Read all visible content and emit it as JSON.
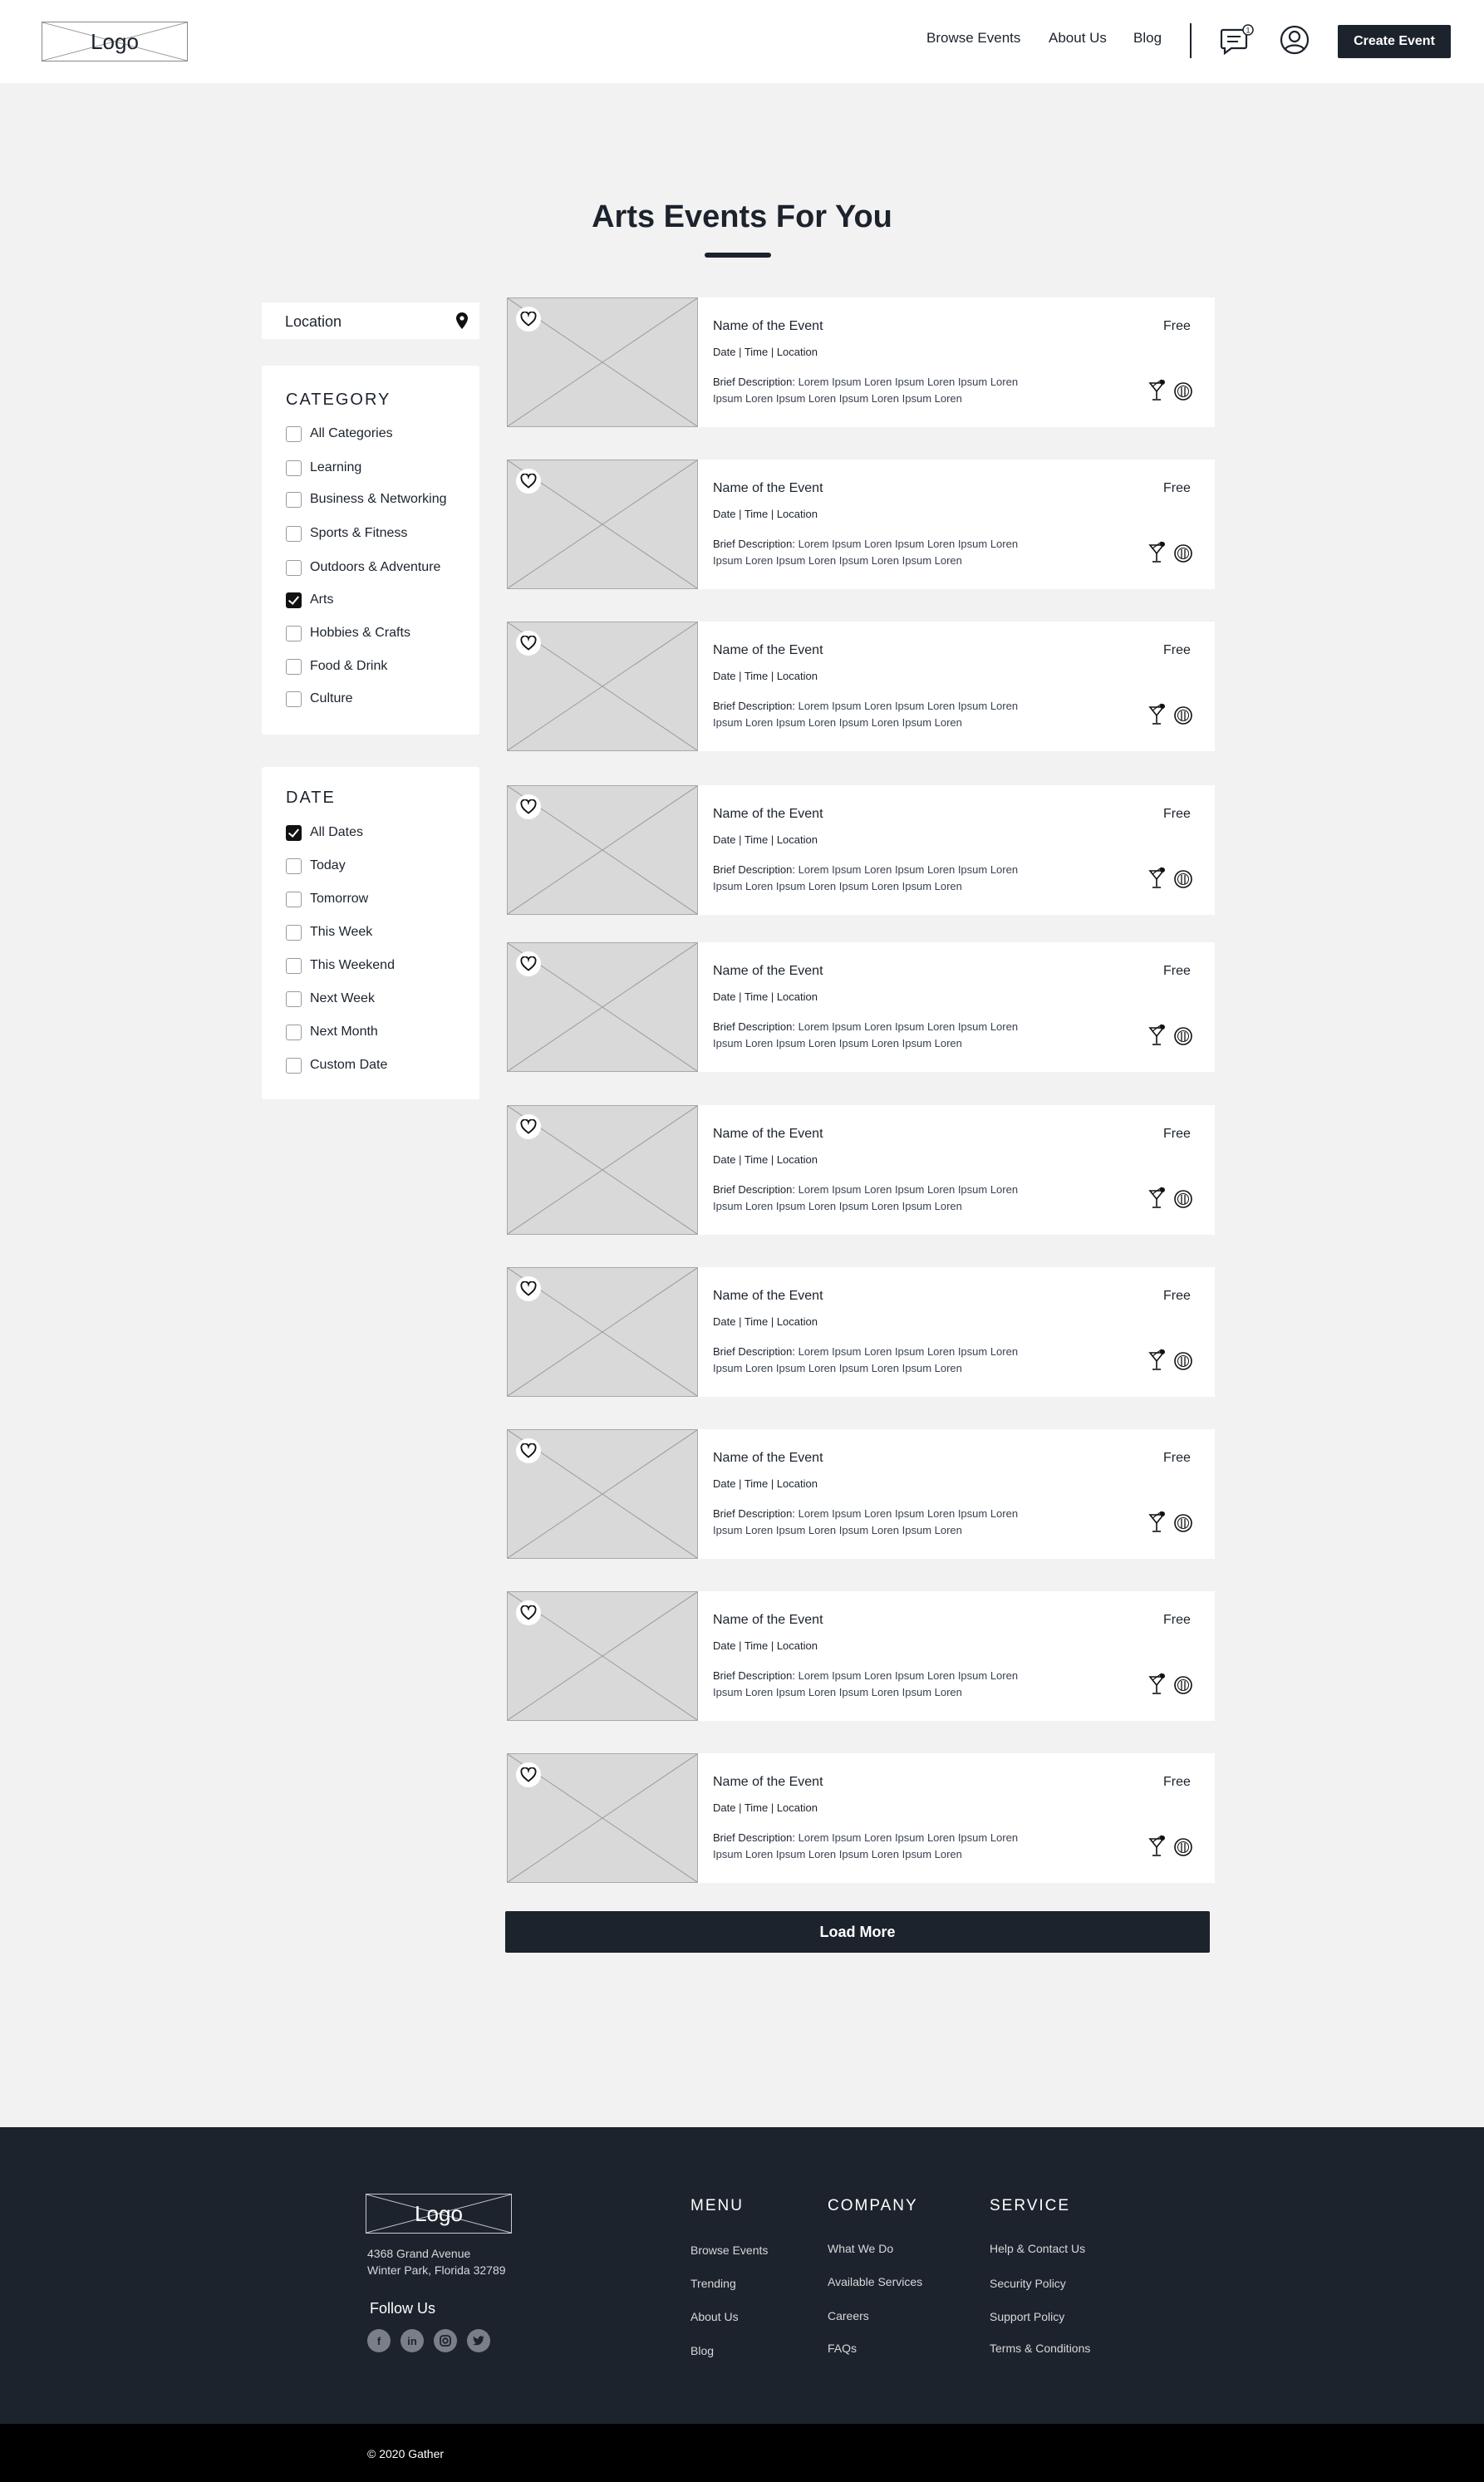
{
  "header": {
    "logo": "Logo",
    "nav": [
      "Browse Events",
      "About Us",
      "Blog"
    ],
    "chat_badge": "1",
    "create_button": "Create Event"
  },
  "page": {
    "title": "Arts Events For You"
  },
  "sidebar": {
    "location_label": "Location",
    "category": {
      "title": "CATEGORY",
      "items": [
        {
          "label": "All Categories",
          "checked": false
        },
        {
          "label": "Learning",
          "checked": false
        },
        {
          "label": "Business & Networking",
          "checked": false
        },
        {
          "label": "Sports & Fitness",
          "checked": false
        },
        {
          "label": "Outdoors & Adventure",
          "checked": false
        },
        {
          "label": "Arts",
          "checked": true
        },
        {
          "label": "Hobbies & Crafts",
          "checked": false
        },
        {
          "label": "Food & Drink",
          "checked": false
        },
        {
          "label": "Culture",
          "checked": false
        }
      ]
    },
    "date": {
      "title": "DATE",
      "items": [
        {
          "label": "All Dates",
          "checked": true
        },
        {
          "label": "Today",
          "checked": false
        },
        {
          "label": "Tomorrow",
          "checked": false
        },
        {
          "label": "This Week",
          "checked": false
        },
        {
          "label": "This Weekend",
          "checked": false
        },
        {
          "label": "Next Week",
          "checked": false
        },
        {
          "label": "Next Month",
          "checked": false
        },
        {
          "label": "Custom Date",
          "checked": false
        }
      ]
    }
  },
  "events": [
    {
      "name": "Name of the Event",
      "meta": "Date | Time | Location",
      "desc_label": "Brief Description:",
      "desc": "Lorem Ipsum Loren Ipsum Loren Ipsum Loren Ipsum Loren Ipsum Loren Ipsum Loren Ipsum Loren",
      "price": "Free"
    },
    {
      "name": "Name of the Event",
      "meta": "Date | Time | Location",
      "desc_label": "Brief Description:",
      "desc": "Lorem Ipsum Loren Ipsum Loren Ipsum Loren Ipsum Loren Ipsum Loren Ipsum Loren Ipsum Loren",
      "price": "Free"
    },
    {
      "name": "Name of the Event",
      "meta": "Date | Time | Location",
      "desc_label": "Brief Description:",
      "desc": "Lorem Ipsum Loren Ipsum Loren Ipsum Loren Ipsum Loren Ipsum Loren Ipsum Loren Ipsum Loren",
      "price": "Free"
    },
    {
      "name": "Name of the Event",
      "meta": "Date | Time | Location",
      "desc_label": "Brief Description:",
      "desc": "Lorem Ipsum Loren Ipsum Loren Ipsum Loren Ipsum Loren Ipsum Loren Ipsum Loren Ipsum Loren",
      "price": "Free"
    },
    {
      "name": "Name of the Event",
      "meta": "Date | Time | Location",
      "desc_label": "Brief Description:",
      "desc": "Lorem Ipsum Loren Ipsum Loren Ipsum Loren Ipsum Loren Ipsum Loren Ipsum Loren Ipsum Loren",
      "price": "Free"
    },
    {
      "name": "Name of the Event",
      "meta": "Date | Time | Location",
      "desc_label": "Brief Description:",
      "desc": "Lorem Ipsum Loren Ipsum Loren Ipsum Loren Ipsum Loren Ipsum Loren Ipsum Loren Ipsum Loren",
      "price": "Free"
    },
    {
      "name": "Name of the Event",
      "meta": "Date | Time | Location",
      "desc_label": "Brief Description:",
      "desc": "Lorem Ipsum Loren Ipsum Loren Ipsum Loren Ipsum Loren Ipsum Loren Ipsum Loren Ipsum Loren",
      "price": "Free"
    },
    {
      "name": "Name of the Event",
      "meta": "Date | Time | Location",
      "desc_label": "Brief Description:",
      "desc": "Lorem Ipsum Loren Ipsum Loren Ipsum Loren Ipsum Loren Ipsum Loren Ipsum Loren Ipsum Loren",
      "price": "Free"
    },
    {
      "name": "Name of the Event",
      "meta": "Date | Time | Location",
      "desc_label": "Brief Description:",
      "desc": "Lorem Ipsum Loren Ipsum Loren Ipsum Loren Ipsum Loren Ipsum Loren Ipsum Loren Ipsum Loren",
      "price": "Free"
    },
    {
      "name": "Name of the Event",
      "meta": "Date | Time | Location",
      "desc_label": "Brief Description:",
      "desc": "Lorem Ipsum Loren Ipsum Loren Ipsum Loren Ipsum Loren Ipsum Loren Ipsum Loren Ipsum Loren",
      "price": "Free"
    }
  ],
  "load_more": "Load More",
  "footer": {
    "logo": "Logo",
    "address_line1": "4368 Grand Avenue",
    "address_line2": "Winter Park, Florida 32789",
    "follow_us": "Follow Us",
    "social_icons": [
      "facebook-icon",
      "linkedin-icon",
      "instagram-icon",
      "twitter-icon"
    ],
    "menu": {
      "title": "MENU",
      "links": [
        "Browse Events",
        "Trending",
        "About Us",
        "Blog"
      ]
    },
    "company": {
      "title": "COMPANY",
      "links": [
        "What We Do",
        "Available Services",
        "Careers",
        "FAQs"
      ]
    },
    "service": {
      "title": "SERVICE",
      "links": [
        "Help & Contact Us",
        "Security Policy",
        "Support Policy",
        "Terms & Conditions"
      ]
    },
    "copyright": "© 2020 Gather"
  }
}
